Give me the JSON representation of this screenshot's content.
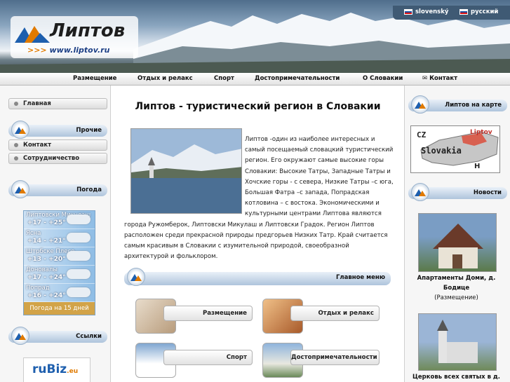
{
  "header": {
    "logo_title": "Липтов",
    "logo_url_prefix": ">>>",
    "logo_url": "www.liptov.ru",
    "languages": [
      {
        "label": "slovenský"
      },
      {
        "label": "русский"
      }
    ]
  },
  "nav": {
    "items": [
      "Размещение",
      "Отдых и релакс",
      "Спорт",
      "Достопримечательности",
      "О Словакии",
      "Контакт"
    ]
  },
  "left": {
    "home": "Главная",
    "other_header": "Прочие",
    "contact": "Контакт",
    "cooperation": "Сотрудничество",
    "weather_header": "Погода",
    "weather": [
      {
        "city": "Липтовски Микулаш",
        "temp": "+17 - +25°"
      },
      {
        "city": "Ясна",
        "temp": "+14 - +21°"
      },
      {
        "city": "Штрбске Плесо",
        "temp": "+13 - +20°"
      },
      {
        "city": "Доновалы",
        "temp": "+17 - +24°"
      },
      {
        "city": "Попрад",
        "temp": "+16 - +24°"
      }
    ],
    "weather_footer": "Погода на 15 дней",
    "links_header": "Ссылки",
    "banner": "ruBiz",
    "banner_suffix": ".eu"
  },
  "main": {
    "title": "Липтов - туристический регион в Словакии",
    "intro": "Липтов -один из наиболее интересных и самый посещаемый словацкий туристический регион. Его окружают самые высокие горы Словакии: Высокие Татры, Западные Татры и Хочские горы - с севера, Низкие Татры –с юга, Большая Фатра –с запада, Попрадская котловина – с востока. Экономическими и культурными центрами Липтова являются города Ружомберок, Липтовски Микулаш и Липтовски Градок. Регион Липтов расположен среди прекрасной природы предгорьев Низких Татр. Край считается самым красивым в Словакии с изумительной природой, своеобразной архитектурой и фольклором.",
    "menu_header": "Главное меню",
    "menu": [
      "Размещение",
      "Отдых и релакс",
      "Спорт",
      "Достопримечательности"
    ]
  },
  "right": {
    "map_header": "Липтов на карте",
    "map_labels": {
      "cz": "CZ",
      "country": "Slovakia",
      "region": "Liptov",
      "h": "H"
    },
    "news_header": "Новости",
    "news": [
      {
        "title": "Апартаменты Доми, д. Бодице",
        "category": "(Размещение)"
      },
      {
        "title": "Церковь всех святых в д."
      }
    ]
  }
}
